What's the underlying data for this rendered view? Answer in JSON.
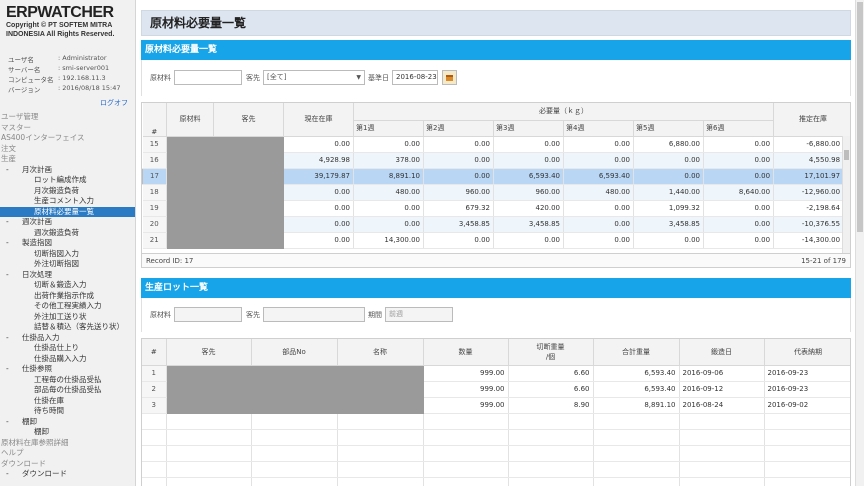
{
  "logo": {
    "text": "ERPWATCHER",
    "copyright1": "Copyright © PT SOFTEM MITRA",
    "copyright2": "INDONESIA All Rights Reserved."
  },
  "user_info": [
    {
      "k": "ユーザ名",
      "v": ": Administrator"
    },
    {
      "k": "サーバー名",
      "v": ": smi-server001"
    },
    {
      "k": "コンピュータ名",
      "v": ": 192.168.11.3"
    },
    {
      "k": "バージョン",
      "v": ": 2016/08/18 15:47"
    }
  ],
  "logout": "ログオフ",
  "menu": [
    {
      "label": "ユーザ管理",
      "lvl": 0
    },
    {
      "label": "マスター",
      "lvl": 0
    },
    {
      "label": "AS400インターフェイス",
      "lvl": 0
    },
    {
      "label": "注文",
      "lvl": 0
    },
    {
      "label": "生産",
      "lvl": 0
    },
    {
      "label": "月次計画",
      "lvl": 1,
      "tog": true
    },
    {
      "label": "ロット編成作成",
      "lvl": 2
    },
    {
      "label": "月次鍛造負荷",
      "lvl": 2
    },
    {
      "label": "生産コメント入力",
      "lvl": 2
    },
    {
      "label": "原材料必要量一覧",
      "lvl": 2,
      "active": true
    },
    {
      "label": "週次計画",
      "lvl": 1,
      "tog": true
    },
    {
      "label": "週次鍛造負荷",
      "lvl": 2
    },
    {
      "label": "製造指図",
      "lvl": 1,
      "tog": true
    },
    {
      "label": "切断指図入力",
      "lvl": 2
    },
    {
      "label": "外注切断指図",
      "lvl": 2
    },
    {
      "label": "日次処理",
      "lvl": 1,
      "tog": true
    },
    {
      "label": "切断＆鍛造入力",
      "lvl": 2
    },
    {
      "label": "出荷作業指示作成",
      "lvl": 2
    },
    {
      "label": "その他工程実績入力",
      "lvl": 2
    },
    {
      "label": "外注加工送り状",
      "lvl": 2
    },
    {
      "label": "詰替＆積込（客先送り状）",
      "lvl": 2
    },
    {
      "label": "仕掛品入力",
      "lvl": 1,
      "tog": true
    },
    {
      "label": "仕掛品仕上り",
      "lvl": 2
    },
    {
      "label": "仕掛品購入入力",
      "lvl": 2
    },
    {
      "label": "仕掛参照",
      "lvl": 1,
      "tog": true
    },
    {
      "label": "工程毎の仕掛品受払",
      "lvl": 2
    },
    {
      "label": "部品毎の仕掛品受払",
      "lvl": 2
    },
    {
      "label": "仕掛在庫",
      "lvl": 2
    },
    {
      "label": "待ち時間",
      "lvl": 2
    },
    {
      "label": "棚卸",
      "lvl": 1,
      "tog": true
    },
    {
      "label": "棚卸",
      "lvl": 2
    },
    {
      "label": "原材料在庫参照詳細",
      "lvl": 0
    },
    {
      "label": "ヘルプ",
      "lvl": 0
    },
    {
      "label": "ダウンロード",
      "lvl": 0
    },
    {
      "label": "ダウンロード",
      "lvl": 1,
      "tog": true
    }
  ],
  "page_title": "原材料必要量一覧",
  "panel1": {
    "title": "原材料必要量一覧",
    "material_label": "原材料",
    "material_value": "",
    "customer_label": "客先",
    "customer_value": "[全て]",
    "date_label": "基準日",
    "date_value": "2016-08-23"
  },
  "grid1": {
    "headers": {
      "rn": "#",
      "material": "原材料",
      "customer": "客先",
      "stock": "現在在庫",
      "required": "必要量（ｋｇ）",
      "est": "推定在庫"
    },
    "weeks": [
      "第1週",
      "第2週",
      "第3週",
      "第4週",
      "第5週",
      "第6週"
    ],
    "rows": [
      {
        "n": "15",
        "stock": "0.00",
        "w": [
          "0.00",
          "0.00",
          "0.00",
          "0.00",
          "6,880.00",
          "0.00"
        ],
        "est": "-6,880.00"
      },
      {
        "n": "16",
        "stock": "4,928.98",
        "w": [
          "378.00",
          "0.00",
          "0.00",
          "0.00",
          "0.00",
          "0.00"
        ],
        "est": "4,550.98"
      },
      {
        "n": "17",
        "stock": "39,179.87",
        "w": [
          "8,891.10",
          "0.00",
          "6,593.40",
          "6,593.40",
          "0.00",
          "0.00"
        ],
        "est": "17,101.97",
        "selected": true
      },
      {
        "n": "18",
        "stock": "0.00",
        "w": [
          "480.00",
          "960.00",
          "960.00",
          "480.00",
          "1,440.00",
          "8,640.00"
        ],
        "est": "-12,960.00"
      },
      {
        "n": "19",
        "stock": "0.00",
        "w": [
          "0.00",
          "679.32",
          "420.00",
          "0.00",
          "1,099.32",
          "0.00"
        ],
        "est": "-2,198.64"
      },
      {
        "n": "20",
        "stock": "0.00",
        "w": [
          "0.00",
          "3,458.85",
          "3,458.85",
          "0.00",
          "3,458.85",
          "0.00"
        ],
        "est": "-10,376.55"
      },
      {
        "n": "21",
        "stock": "0.00",
        "w": [
          "14,300.00",
          "0.00",
          "0.00",
          "0.00",
          "0.00",
          "0.00"
        ],
        "est": "-14,300.00"
      }
    ],
    "record_id": "Record ID: 17",
    "paging": "15-21 of 179"
  },
  "panel2": {
    "title": "生産ロット一覧",
    "material_label": "原材料",
    "customer_label": "客先",
    "period_label": "期間",
    "period_value": "前週"
  },
  "grid2": {
    "headers": {
      "rn": "#",
      "customer": "客先",
      "part": "部品No",
      "name": "名称",
      "qty": "数量",
      "cutw1": "切断重量",
      "cutw2": "/個",
      "total": "合計重量",
      "forge": "鍛造日",
      "due": "代表納期"
    },
    "rows": [
      {
        "n": "1",
        "qty": "999.00",
        "cutw": "6.60",
        "total": "6,593.40",
        "forge": "2016-09-06",
        "due": "2016-09-23"
      },
      {
        "n": "2",
        "qty": "999.00",
        "cutw": "6.60",
        "total": "6,593.40",
        "forge": "2016-09-12",
        "due": "2016-09-23"
      },
      {
        "n": "3",
        "qty": "999.00",
        "cutw": "8.90",
        "total": "8,891.10",
        "forge": "2016-08-24",
        "due": "2016-09-02"
      }
    ]
  }
}
